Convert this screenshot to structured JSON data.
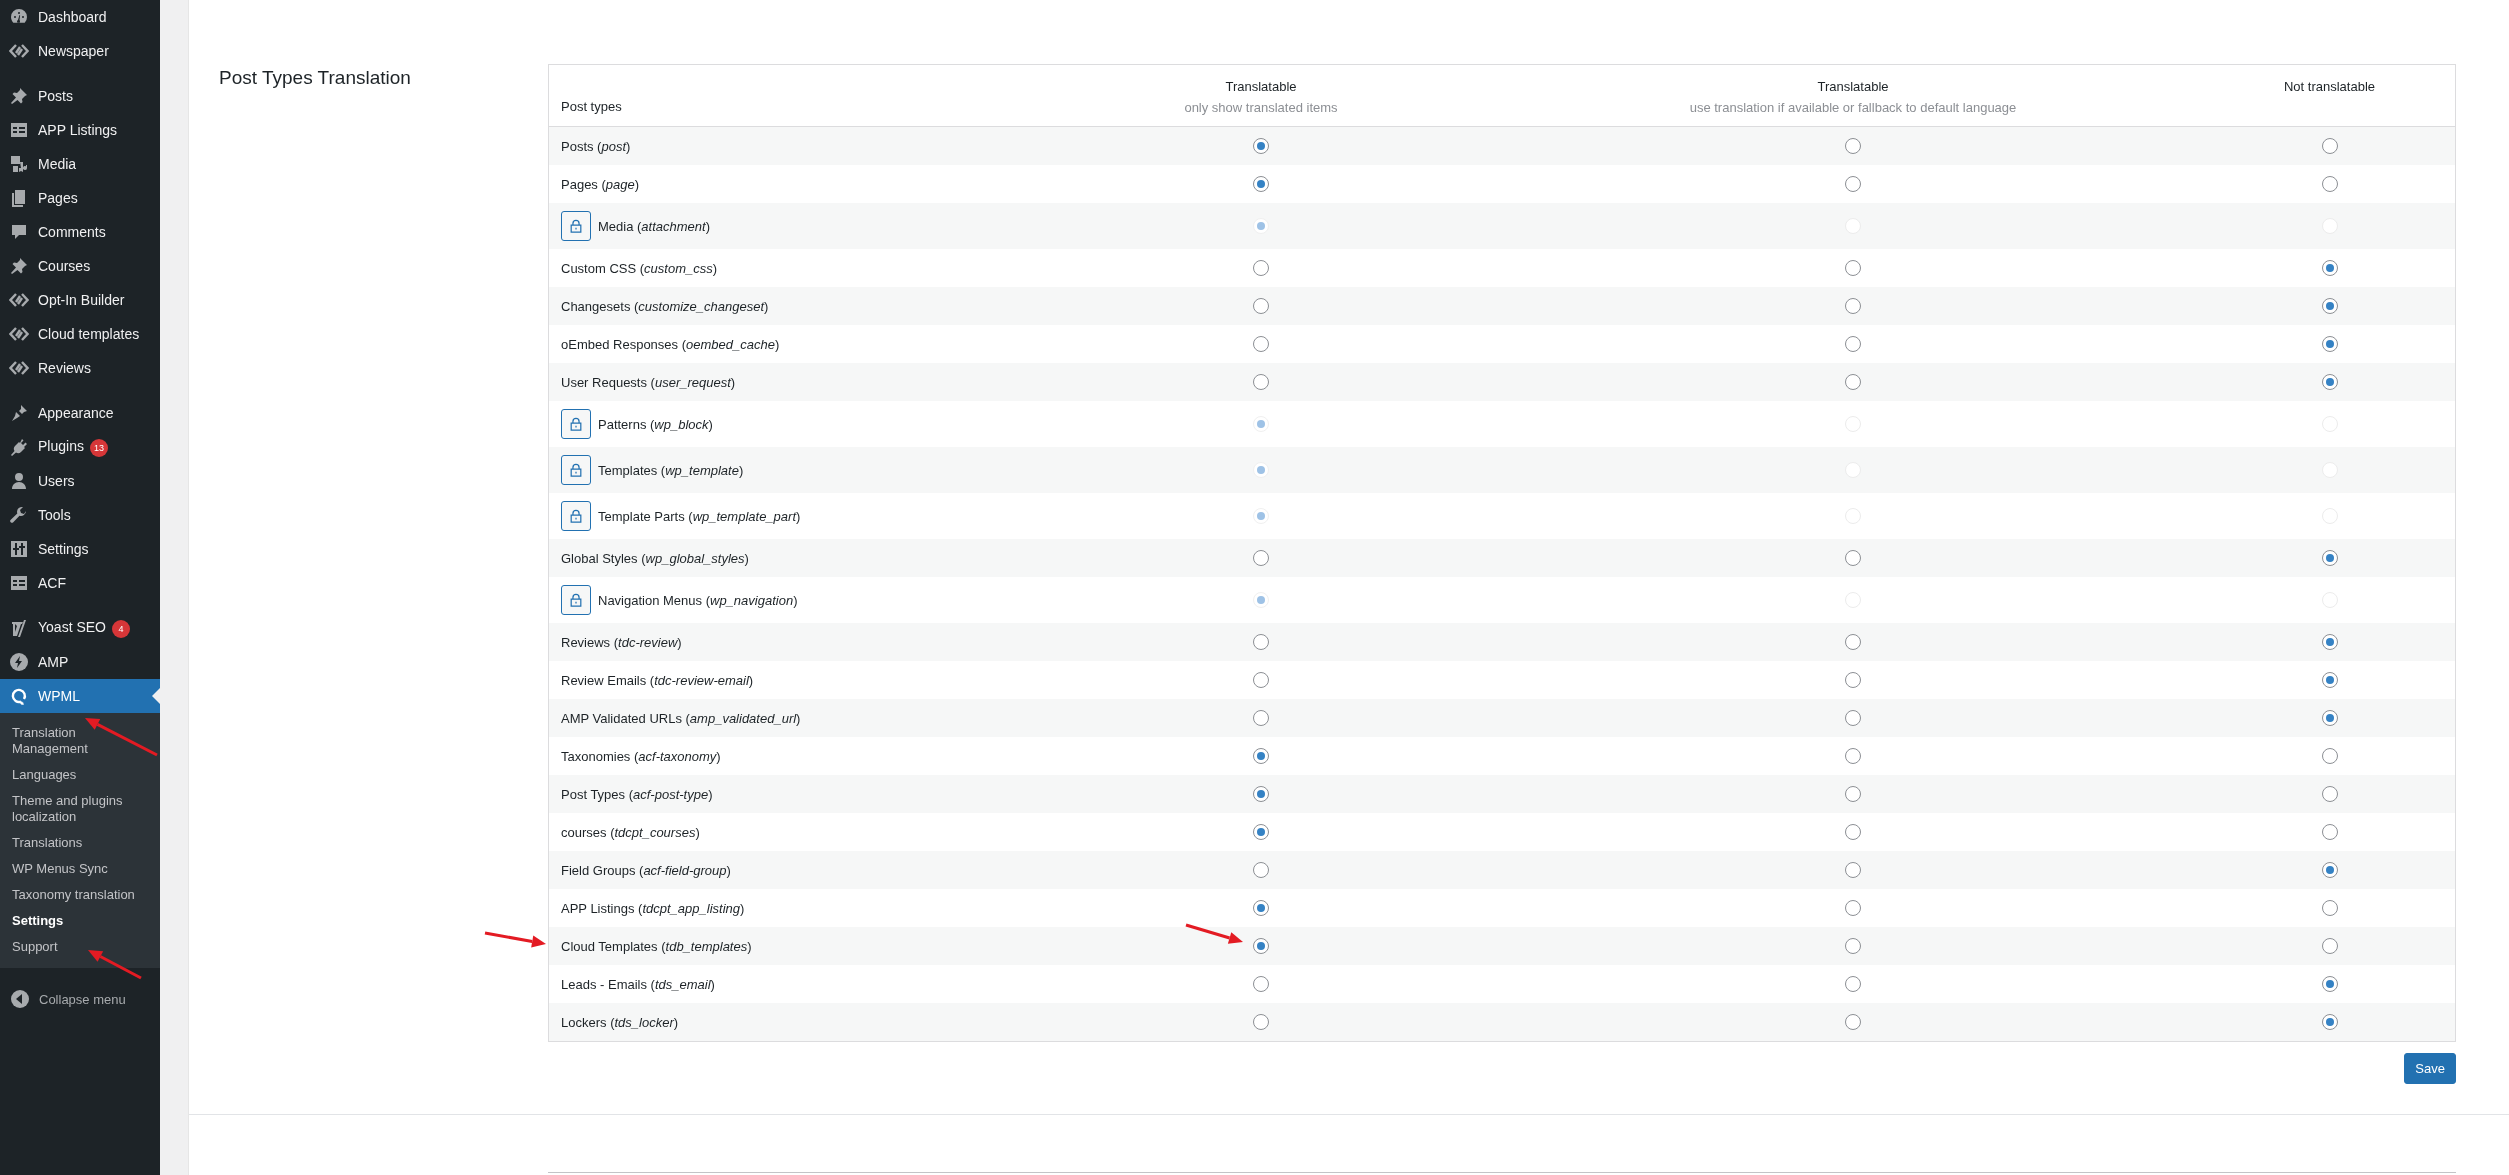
{
  "sidebar": {
    "groups": [
      [
        {
          "label": "Dashboard",
          "selected": false
        },
        {
          "label": "Newspaper",
          "selected": false
        }
      ],
      [
        {
          "label": "Posts",
          "selected": false
        },
        {
          "label": "APP Listings",
          "selected": false
        },
        {
          "label": "Media",
          "selected": false
        },
        {
          "label": "Pages",
          "selected": false
        },
        {
          "label": "Comments",
          "selected": false
        },
        {
          "label": "Courses",
          "selected": false
        },
        {
          "label": "Opt-In Builder",
          "selected": false
        },
        {
          "label": "Cloud templates",
          "selected": false
        },
        {
          "label": "Reviews",
          "selected": false
        }
      ],
      [
        {
          "label": "Appearance",
          "selected": false
        },
        {
          "label": "Plugins",
          "selected": false,
          "badge": "13"
        },
        {
          "label": "Users",
          "selected": false
        },
        {
          "label": "Tools",
          "selected": false
        },
        {
          "label": "Settings",
          "selected": false
        },
        {
          "label": "ACF",
          "selected": false
        }
      ],
      [
        {
          "label": "Yoast SEO",
          "selected": false,
          "badge": "4"
        },
        {
          "label": "AMP",
          "selected": false
        },
        {
          "label": "WPML",
          "selected": true,
          "children": [
            {
              "label": "Translation Management",
              "selected": false
            },
            {
              "label": "Languages",
              "selected": false
            },
            {
              "label": "Theme and plugins localization",
              "selected": false
            },
            {
              "label": "Translations",
              "selected": false
            },
            {
              "label": "WP Menus Sync",
              "selected": false
            },
            {
              "label": "Taxonomy translation",
              "selected": false
            },
            {
              "label": "Settings",
              "selected": true
            },
            {
              "label": "Support",
              "selected": false
            }
          ]
        }
      ]
    ],
    "collapse_label": "Collapse menu"
  },
  "section": {
    "title": "Post Types Translation",
    "columns": [
      {
        "title": "Post types"
      },
      {
        "title": "Translatable",
        "subtitle": "only show translated items"
      },
      {
        "title": "Translatable",
        "subtitle": "use translation if available or fallback to default language"
      },
      {
        "title": "Not translatable"
      }
    ],
    "rows": [
      {
        "label": "Posts (*post*)",
        "locked": false,
        "options": [
          {
            "selected": true
          },
          {
            "selected": false
          },
          {
            "selected": false
          }
        ]
      },
      {
        "label": "Pages (*page*)",
        "locked": false,
        "options": [
          {
            "selected": true
          },
          {
            "selected": false
          },
          {
            "selected": false
          }
        ]
      },
      {
        "label": "Media (*attachment*)",
        "locked": true,
        "options": [
          {
            "selected": true
          },
          {
            "selected": false
          },
          {
            "selected": false
          }
        ]
      },
      {
        "label": "Custom CSS (*custom_css*)",
        "locked": false,
        "options": [
          {
            "selected": false
          },
          {
            "selected": false
          },
          {
            "selected": true
          }
        ]
      },
      {
        "label": "Changesets (*customize_changeset*)",
        "locked": false,
        "options": [
          {
            "selected": false
          },
          {
            "selected": false
          },
          {
            "selected": true
          }
        ]
      },
      {
        "label": "oEmbed Responses (*oembed_cache*)",
        "locked": false,
        "options": [
          {
            "selected": false
          },
          {
            "selected": false
          },
          {
            "selected": true
          }
        ]
      },
      {
        "label": "User Requests (*user_request*)",
        "locked": false,
        "options": [
          {
            "selected": false
          },
          {
            "selected": false
          },
          {
            "selected": true
          }
        ]
      },
      {
        "label": "Patterns (*wp_block*)",
        "locked": true,
        "options": [
          {
            "selected": true
          },
          {
            "selected": false
          },
          {
            "selected": false
          }
        ]
      },
      {
        "label": "Templates (*wp_template*)",
        "locked": true,
        "options": [
          {
            "selected": true
          },
          {
            "selected": false
          },
          {
            "selected": false
          }
        ]
      },
      {
        "label": "Template Parts (*wp_template_part*)",
        "locked": true,
        "options": [
          {
            "selected": true
          },
          {
            "selected": false
          },
          {
            "selected": false
          }
        ]
      },
      {
        "label": "Global Styles (*wp_global_styles*)",
        "locked": false,
        "options": [
          {
            "selected": false
          },
          {
            "selected": false
          },
          {
            "selected": true
          }
        ]
      },
      {
        "label": "Navigation Menus (*wp_navigation*)",
        "locked": true,
        "options": [
          {
            "selected": true
          },
          {
            "selected": false
          },
          {
            "selected": false
          }
        ]
      },
      {
        "label": "Reviews (*tdc-review*)",
        "locked": false,
        "options": [
          {
            "selected": false
          },
          {
            "selected": false
          },
          {
            "selected": true
          }
        ]
      },
      {
        "label": "Review Emails (*tdc-review-email*)",
        "locked": false,
        "options": [
          {
            "selected": false
          },
          {
            "selected": false
          },
          {
            "selected": true
          }
        ]
      },
      {
        "label": "AMP Validated URLs (*amp_validated_url*)",
        "locked": false,
        "options": [
          {
            "selected": false
          },
          {
            "selected": false
          },
          {
            "selected": true
          }
        ]
      },
      {
        "label": "Taxonomies (*acf-taxonomy*)",
        "locked": false,
        "options": [
          {
            "selected": true
          },
          {
            "selected": false
          },
          {
            "selected": false
          }
        ]
      },
      {
        "label": "Post Types (*acf-post-type*)",
        "locked": false,
        "options": [
          {
            "selected": true
          },
          {
            "selected": false
          },
          {
            "selected": false
          }
        ]
      },
      {
        "label": "courses (*tdcpt_courses*)",
        "locked": false,
        "options": [
          {
            "selected": true
          },
          {
            "selected": false
          },
          {
            "selected": false
          }
        ]
      },
      {
        "label": "Field Groups (*acf-field-group*)",
        "locked": false,
        "options": [
          {
            "selected": false
          },
          {
            "selected": false
          },
          {
            "selected": true
          }
        ]
      },
      {
        "label": "APP Listings (*tdcpt_app_listing*)",
        "locked": false,
        "options": [
          {
            "selected": true
          },
          {
            "selected": false
          },
          {
            "selected": false
          }
        ]
      },
      {
        "label": "Cloud Templates (*tdb_templates*)",
        "locked": false,
        "options": [
          {
            "selected": true
          },
          {
            "selected": false
          },
          {
            "selected": false
          }
        ]
      },
      {
        "label": "Leads - Emails (*tds_email*)",
        "locked": false,
        "options": [
          {
            "selected": false
          },
          {
            "selected": false
          },
          {
            "selected": true
          }
        ]
      },
      {
        "label": "Lockers (*tds_locker*)",
        "locked": false,
        "options": [
          {
            "selected": false
          },
          {
            "selected": false
          },
          {
            "selected": true
          }
        ]
      }
    ],
    "save_label": "Save"
  }
}
